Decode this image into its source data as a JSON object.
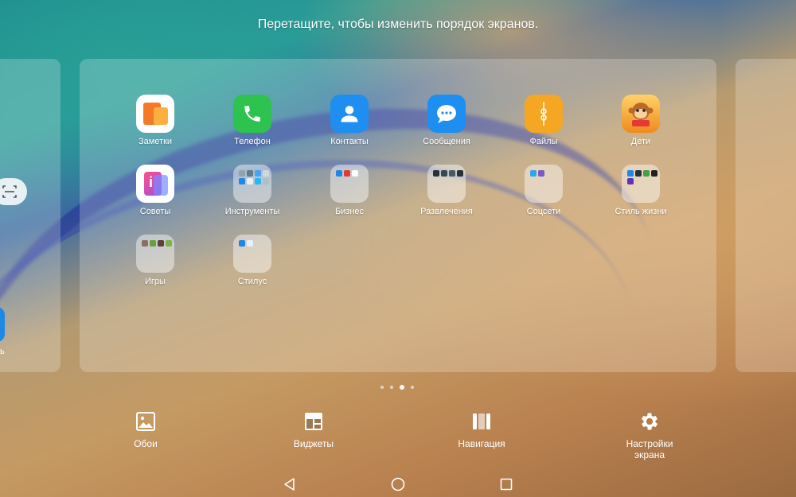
{
  "hint": "Перетащите, чтобы изменить порядок экранов.",
  "left_panel": {
    "partial_label": "ь"
  },
  "apps": [
    {
      "label": "Заметки"
    },
    {
      "label": "Телефон"
    },
    {
      "label": "Контакты"
    },
    {
      "label": "Сообщения"
    },
    {
      "label": "Файлы"
    },
    {
      "label": "Дети"
    },
    {
      "label": "Советы"
    },
    {
      "label": "Инструменты"
    },
    {
      "label": "Бизнес"
    },
    {
      "label": "Развлечения"
    },
    {
      "label": "Соцсети"
    },
    {
      "label": "Стиль жизни"
    },
    {
      "label": "Игры"
    },
    {
      "label": "Стилус"
    }
  ],
  "page_indicator": {
    "count": 4,
    "active": 3
  },
  "toolbar": {
    "wallpaper": "Обои",
    "widgets": "Виджеты",
    "navigation": "Навигация",
    "screen_settings_line1": "Настройки",
    "screen_settings_line2": "экрана"
  },
  "colors": {
    "notes": "#f47a2a",
    "phone": "#2ec24f",
    "contacts": "#1e8ff0",
    "messages": "#1e8ff0",
    "files": "#f5a623",
    "kids": "#f08a1d",
    "tips": "#e8337a"
  }
}
